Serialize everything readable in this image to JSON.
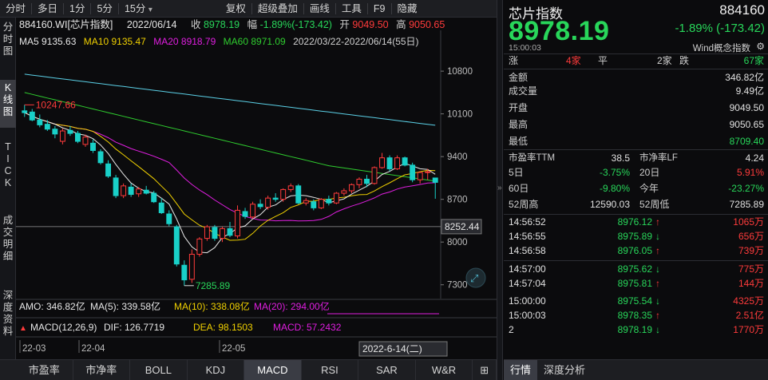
{
  "toolbar": {
    "left_items": [
      "分时",
      "多日",
      "1分",
      "5分",
      "15分"
    ],
    "dropdown_caret": "▾",
    "right_items": [
      "复权",
      "超级叠加",
      "画线",
      "工具",
      "F9",
      "隐藏"
    ]
  },
  "leftnav": {
    "items": [
      {
        "label": "分\n时\n图",
        "active": false
      },
      {
        "label": "K\n线\n图",
        "active": true
      },
      {
        "label": "T\nI\nC\nK",
        "active": false
      },
      {
        "label": "成\n交\n明\n细",
        "active": false
      },
      {
        "label": "深\n度\n资\n料",
        "active": false
      }
    ]
  },
  "chart": {
    "info": {
      "code_name": "884160.WI[芯片指数]",
      "date": "2022/06/14",
      "close_label": "收",
      "close_value": "8978.19",
      "amp_label": "幅",
      "amp_value": "-1.89%(-173.42)",
      "open_label": "开",
      "open_value": "9049.50",
      "high_label": "高",
      "high_value": "9050.65"
    },
    "ma": {
      "ma5_label": "MA5",
      "ma5_value": "9135.63",
      "ma10_label": "MA10",
      "ma10_value": "9135.47",
      "ma20_label": "MA20",
      "ma20_value": "8918.79",
      "ma60_label": "MA60",
      "ma60_value": "8971.09",
      "range_text": "2022/03/22-2022/06/14(55日)"
    },
    "colors": {
      "up": "#ff3b3b",
      "down": "#19d0c8",
      "ma5": "#e8e8e8",
      "ma10": "#f0d000",
      "ma20": "#e01ee0",
      "ma60": "#2fcd2f",
      "ma120": "#5bd0e6"
    },
    "price_axis": {
      "min": 7100,
      "max": 11050,
      "ticks": [
        10800,
        10100,
        9400,
        8700,
        8000,
        7300
      ],
      "tick_labels": [
        "10800",
        "10100",
        "9400",
        "8700",
        "8000",
        "7300"
      ],
      "cursor_value": 8252.44,
      "cursor_label": "8252.44"
    },
    "annotations": {
      "high_label": "10247.66",
      "low_label": "7285.89"
    },
    "dates": [
      "22-03",
      "22-04",
      "22-05"
    ],
    "cursor_date": "2022-6-14(二)",
    "amo": {
      "text": "AMO: 346.82亿",
      "ma5": "MA(5): 339.58亿",
      "ma10": "MA(10): 338.08亿",
      "ma20": "MA(20): 294.00亿"
    },
    "macd": {
      "title": "MACD(12,26,9)",
      "dif": "DIF: 126.7719",
      "dea": "DEA: 98.1503",
      "macd": "MACD: 57.2432"
    }
  },
  "chart_data": {
    "type": "candlestick",
    "title": "884160.WI[芯片指数]",
    "dates": [
      "2022/03/22",
      "2022/03/23",
      "2022/03/24",
      "2022/03/25",
      "2022/03/28",
      "2022/03/29",
      "2022/03/30",
      "2022/03/31",
      "2022/04/01",
      "2022/04/06",
      "2022/04/07",
      "2022/04/08",
      "2022/04/11",
      "2022/04/12",
      "2022/04/13",
      "2022/04/14",
      "2022/04/15",
      "2022/04/18",
      "2022/04/19",
      "2022/04/20",
      "2022/04/21",
      "2022/04/22",
      "2022/04/25",
      "2022/04/26",
      "2022/04/27",
      "2022/04/28",
      "2022/04/29",
      "2022/05/05",
      "2022/05/06",
      "2022/05/09",
      "2022/05/10",
      "2022/05/11",
      "2022/05/12",
      "2022/05/13",
      "2022/05/16",
      "2022/05/17",
      "2022/05/18",
      "2022/05/19",
      "2022/05/20",
      "2022/05/23",
      "2022/05/24",
      "2022/05/25",
      "2022/05/26",
      "2022/05/27",
      "2022/05/30",
      "2022/05/31",
      "2022/06/01",
      "2022/06/02",
      "2022/06/06",
      "2022/06/07",
      "2022/06/08",
      "2022/06/09",
      "2022/06/10",
      "2022/06/13",
      "2022/06/14"
    ],
    "ohlc": [
      [
        10150,
        10247.66,
        10050,
        10120
      ],
      [
        10130,
        10180,
        9980,
        10000
      ],
      [
        10000,
        10090,
        9880,
        9920
      ],
      [
        9930,
        10000,
        9820,
        9850
      ],
      [
        9850,
        9900,
        9700,
        9770
      ],
      [
        9650,
        9860,
        9600,
        9820
      ],
      [
        9830,
        9900,
        9740,
        9780
      ],
      [
        9780,
        9820,
        9620,
        9650
      ],
      [
        9600,
        9760,
        9560,
        9720
      ],
      [
        9620,
        9680,
        9460,
        9500
      ],
      [
        9480,
        9520,
        9270,
        9300
      ],
      [
        9280,
        9340,
        9050,
        9080
      ],
      [
        9050,
        9100,
        8720,
        8760
      ],
      [
        8760,
        8960,
        8720,
        8920
      ],
      [
        8900,
        8960,
        8740,
        8780
      ],
      [
        8790,
        8900,
        8740,
        8870
      ],
      [
        8850,
        8920,
        8780,
        8800
      ],
      [
        8800,
        8840,
        8640,
        8660
      ],
      [
        8640,
        8720,
        8460,
        8480
      ],
      [
        8460,
        8520,
        8260,
        8300
      ],
      [
        8250,
        8280,
        7600,
        7640
      ],
      [
        7620,
        7700,
        7285.89,
        7380
      ],
      [
        7390,
        7880,
        7330,
        7800
      ],
      [
        7800,
        8080,
        7760,
        8050
      ],
      [
        8060,
        8280,
        8020,
        8250
      ],
      [
        8240,
        8280,
        8020,
        8060
      ],
      [
        8060,
        8250,
        8000,
        8220
      ],
      [
        8220,
        8330,
        8080,
        8110
      ],
      [
        8100,
        8600,
        8060,
        8520
      ],
      [
        8500,
        8560,
        8380,
        8420
      ],
      [
        8410,
        8660,
        8380,
        8620
      ],
      [
        8620,
        8700,
        8540,
        8580
      ],
      [
        8570,
        8760,
        8530,
        8720
      ],
      [
        8720,
        8800,
        8660,
        8700
      ],
      [
        8700,
        8880,
        8660,
        8860
      ],
      [
        8860,
        8960,
        8820,
        8920
      ],
      [
        8920,
        8950,
        8620,
        8640
      ],
      [
        8640,
        8720,
        8600,
        8680
      ],
      [
        8660,
        8700,
        8520,
        8560
      ],
      [
        8560,
        8720,
        8540,
        8700
      ],
      [
        8700,
        8760,
        8600,
        8640
      ],
      [
        8640,
        8820,
        8620,
        8800
      ],
      [
        8800,
        8880,
        8760,
        8840
      ],
      [
        8840,
        8960,
        8800,
        8940
      ],
      [
        8940,
        9060,
        8880,
        9030
      ],
      [
        9030,
        9100,
        8900,
        8960
      ],
      [
        8960,
        9240,
        8940,
        9220
      ],
      [
        9220,
        9460,
        9200,
        9380
      ],
      [
        9380,
        9420,
        9160,
        9200
      ],
      [
        9200,
        9420,
        9180,
        9380
      ],
      [
        9380,
        9400,
        9240,
        9260
      ],
      [
        9260,
        9300,
        8980,
        9020
      ],
      [
        9020,
        9160,
        8960,
        9140
      ],
      [
        9140,
        9200,
        9020,
        9151.61
      ],
      [
        9049.5,
        9050.65,
        8709.4,
        8978.19
      ]
    ],
    "ylim": [
      7100,
      11050
    ]
  },
  "right_panel": {
    "title": "芯片指数",
    "code": "884160",
    "price": "8978.19",
    "change": "-1.89% (-173.42)",
    "time": "15:00:03",
    "concept_label": "Wind概念指数",
    "settings_icon": "gear-icon",
    "breadth": {
      "up_label": "涨",
      "up_value": "4家",
      "flat_label": "平",
      "flat_value": "2家",
      "down_label": "跌",
      "down_value": "67家"
    },
    "stats": [
      {
        "k": "金额",
        "v": "346.82亿",
        "color": "white"
      },
      {
        "k": "成交量",
        "v": "9.49亿",
        "color": "white"
      },
      {
        "k": "开盘",
        "v": "9049.50",
        "color": "white"
      },
      {
        "k": "最高",
        "v": "9050.65",
        "color": "white"
      },
      {
        "k": "最低",
        "v": "8709.40",
        "color": "green"
      }
    ],
    "ratios": {
      "pe_label": "市盈率TTM",
      "pe_value": "38.5",
      "pb_label": "市净率LF",
      "pb_value": "4.24",
      "d5_label": "5日",
      "d5_value": "-3.75%",
      "d20_label": "20日",
      "d20_value": "5.91%",
      "d60_label": "60日",
      "d60_value": "-9.80%",
      "ytd_label": "今年",
      "ytd_value": "-23.27%",
      "w52h_label": "52周高",
      "w52h_value": "12590.03",
      "w52l_label": "52周低",
      "w52l_value": "7285.89"
    },
    "tape": [
      {
        "time": "14:56:52",
        "price": "8976.12",
        "dir": "up",
        "vol": "1065万"
      },
      {
        "time": "14:56:55",
        "price": "8975.89",
        "dir": "down",
        "vol": "656万"
      },
      {
        "time": "14:56:58",
        "price": "8976.05",
        "dir": "up",
        "vol": "739万"
      },
      {
        "time": "14:57:00",
        "price": "8975.62",
        "dir": "down",
        "vol": "775万"
      },
      {
        "time": "14:57:04",
        "price": "8975.81",
        "dir": "up",
        "vol": "144万"
      },
      {
        "time": "15:00:00",
        "price": "8975.54",
        "dir": "down",
        "vol": "4325万"
      },
      {
        "time": "15:00:03",
        "price": "8978.35",
        "dir": "up",
        "vol": "2.51亿"
      },
      {
        "time": "2",
        "price": "8978.19",
        "dir": "down",
        "vol": "1770万"
      }
    ],
    "tabs": [
      "行情",
      "深度分析"
    ]
  },
  "bottom_tabs": [
    "市盈率",
    "市净率",
    "BOLL",
    "KDJ",
    "MACD",
    "RSI",
    "SAR",
    "W&R"
  ],
  "bottom_active": "MACD",
  "bottom_more": "⊞"
}
